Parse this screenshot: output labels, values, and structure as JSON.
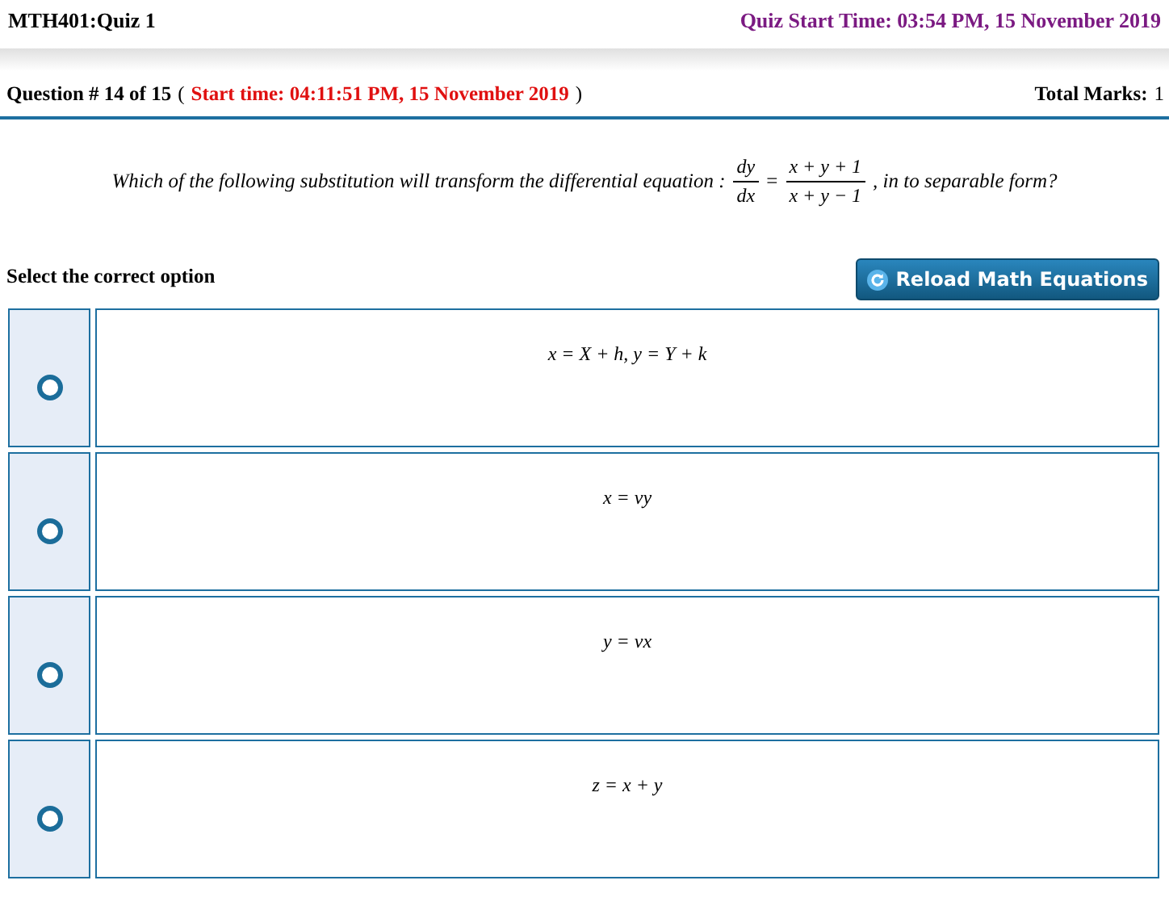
{
  "header": {
    "course": "MTH401:Quiz 1",
    "quiz_start": "Quiz Start Time: 03:54 PM, 15 November 2019"
  },
  "question_bar": {
    "number": "Question # 14 of 15",
    "open_paren": "(",
    "start_time": "Start time: 04:11:51 PM, 15 November 2019",
    "close_paren": ")",
    "marks_label": "Total Marks:",
    "marks": "1"
  },
  "question": {
    "prefix": "Which of the following substitution will transform the differential equation :",
    "lhs_num": "dy",
    "lhs_den": "dx",
    "equals": "=",
    "rhs_num": "x + y + 1",
    "rhs_den": "x + y − 1",
    "suffix": ", in to separable form?"
  },
  "instruction": "Select the correct option",
  "reload_button": "Reload Math Equations",
  "options": [
    {
      "text": "x = X + h, y = Y + k",
      "selected": false
    },
    {
      "text": "x = vy",
      "selected": false
    },
    {
      "text": "y = vx",
      "selected": false
    },
    {
      "text": "z = x + y",
      "selected": false
    }
  ]
}
